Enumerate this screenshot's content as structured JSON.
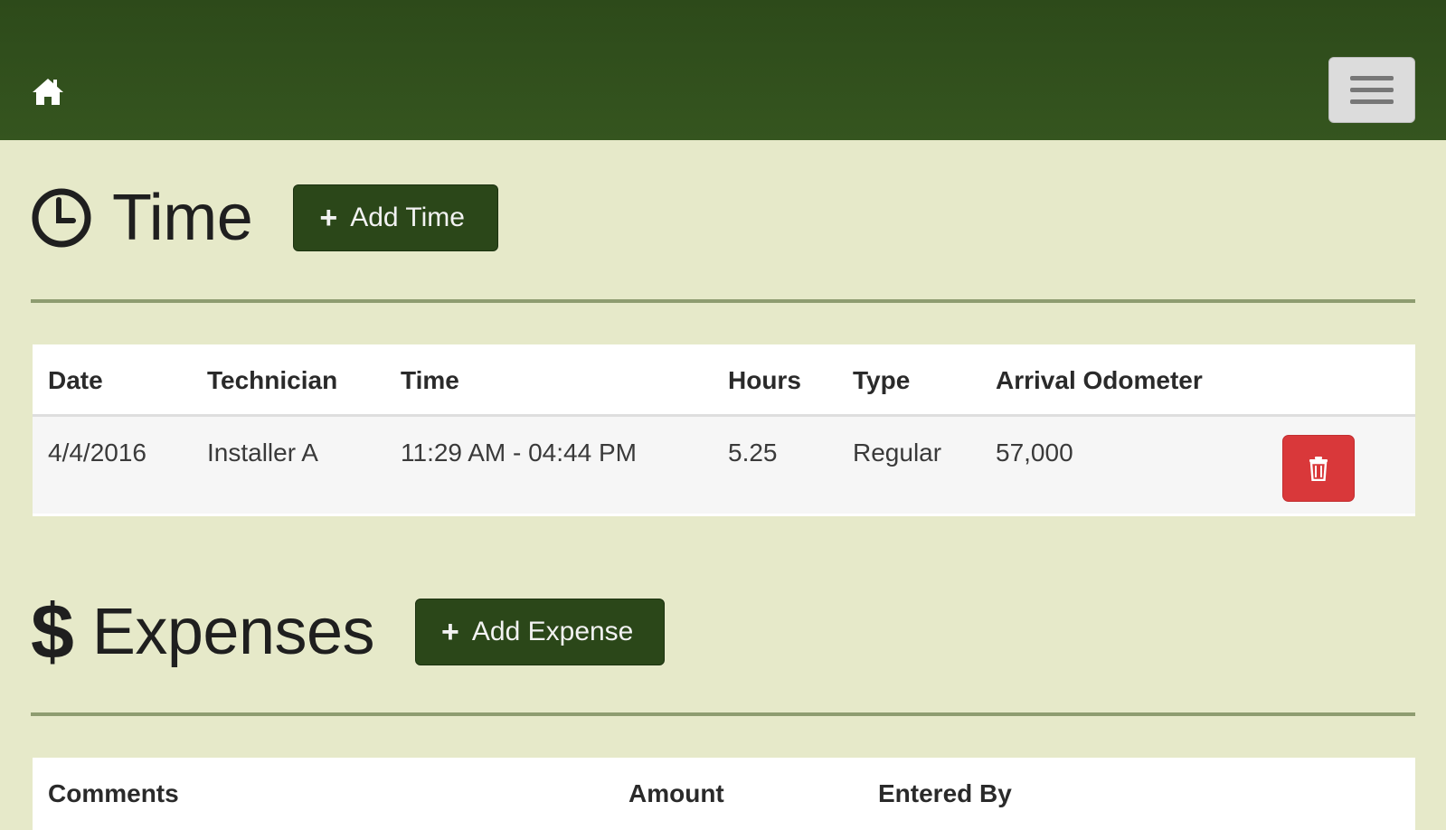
{
  "nav": {
    "home_icon": "home-icon",
    "menu_icon": "hamburger-menu-icon"
  },
  "time_section": {
    "icon": "clock-icon",
    "title": "Time",
    "add_button_label": "Add Time",
    "table": {
      "headers": [
        "Date",
        "Technician",
        "Time",
        "Hours",
        "Type",
        "Arrival Odometer"
      ],
      "rows": [
        {
          "date": "4/4/2016",
          "technician": "Installer A",
          "time": "11:29 AM - 04:44 PM",
          "hours": "5.25",
          "type": "Regular",
          "arrival_odometer": "57,000",
          "action_icon": "trash-icon"
        }
      ]
    }
  },
  "expenses_section": {
    "icon": "$",
    "title": "Expenses",
    "add_button_label": "Add Expense",
    "table": {
      "headers": [
        "Comments",
        "Amount",
        "Entered By"
      ]
    }
  },
  "colors": {
    "nav_bg": "#2d4a1a",
    "page_bg": "#e6e9c9",
    "primary_button": "#2b4719",
    "danger_button": "#d9383a"
  }
}
